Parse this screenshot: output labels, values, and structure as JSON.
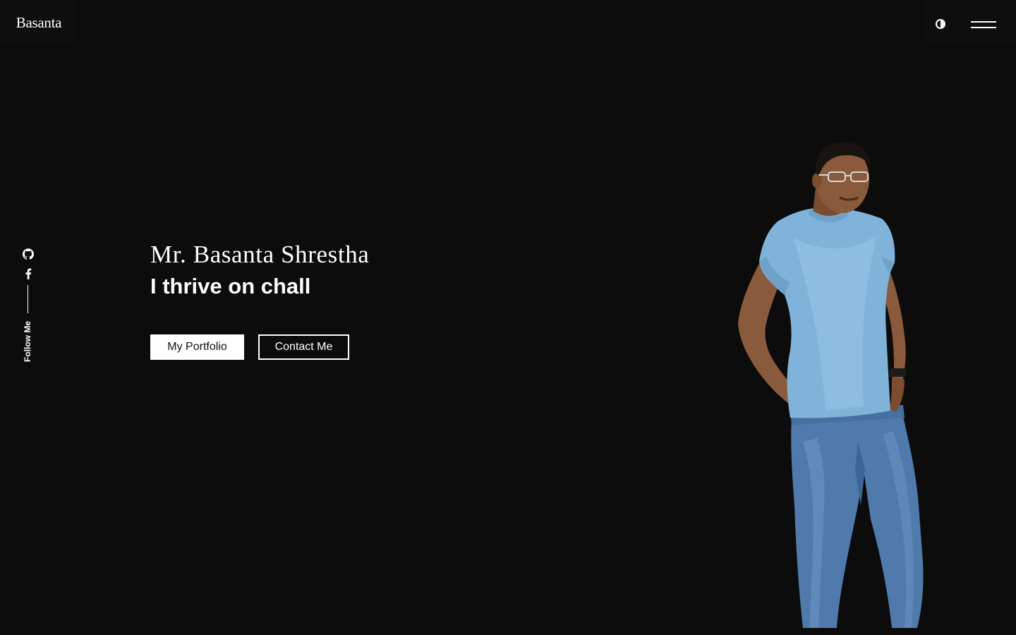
{
  "header": {
    "brand": "Basanta",
    "theme_toggle_icon": "contrast-icon",
    "menu_icon": "hamburger-menu-icon"
  },
  "social": {
    "github_icon": "github-icon",
    "facebook_icon": "facebook-icon",
    "follow_label": "Follow Me"
  },
  "hero": {
    "name": "Mr. Basanta Shrestha",
    "tagline": "I thrive on chall",
    "buttons": {
      "portfolio": "My Portfolio",
      "contact": "Contact Me"
    }
  },
  "colors": {
    "background": "#0c0c0d",
    "text": "#ffffff",
    "shirt": "#7fb3d9",
    "jeans": "#5a86b8"
  }
}
